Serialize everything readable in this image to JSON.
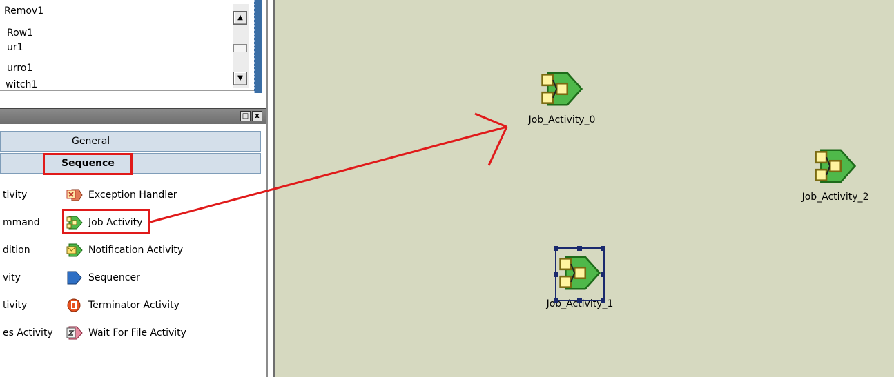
{
  "tree_list": {
    "items": [
      "Remov1",
      "Row1",
      "ur1",
      "urro1",
      "witch1"
    ]
  },
  "palette": {
    "groups": {
      "general": "General",
      "sequence": "Sequence"
    },
    "left_column": [
      "tivity",
      "mmand",
      "dition",
      "vity",
      "tivity",
      "es Activity"
    ],
    "items": [
      {
        "label": "Exception Handler",
        "icon": "exception-handler-icon"
      },
      {
        "label": "Job Activity",
        "icon": "job-activity-icon"
      },
      {
        "label": "Notification Activity",
        "icon": "notification-activity-icon"
      },
      {
        "label": "Sequencer",
        "icon": "sequencer-icon"
      },
      {
        "label": "Terminator Activity",
        "icon": "terminator-activity-icon"
      },
      {
        "label": "Wait For File Activity",
        "icon": "wait-for-file-icon"
      }
    ],
    "title_buttons": [
      "□",
      "x"
    ]
  },
  "canvas": {
    "stages": [
      {
        "label": "Job_Activity_0",
        "icon": "job-activity-icon",
        "selected": false
      },
      {
        "label": "Job_Activity_1",
        "icon": "job-activity-icon",
        "selected": true
      },
      {
        "label": "Job_Activity_2",
        "icon": "job-activity-icon",
        "selected": false
      }
    ]
  },
  "colors": {
    "canvas_bg": "#d6d9c0",
    "annotation_red": "#e01a1a",
    "selection": "#1b2a6e",
    "palette_group_bg": "#d4dfea"
  }
}
